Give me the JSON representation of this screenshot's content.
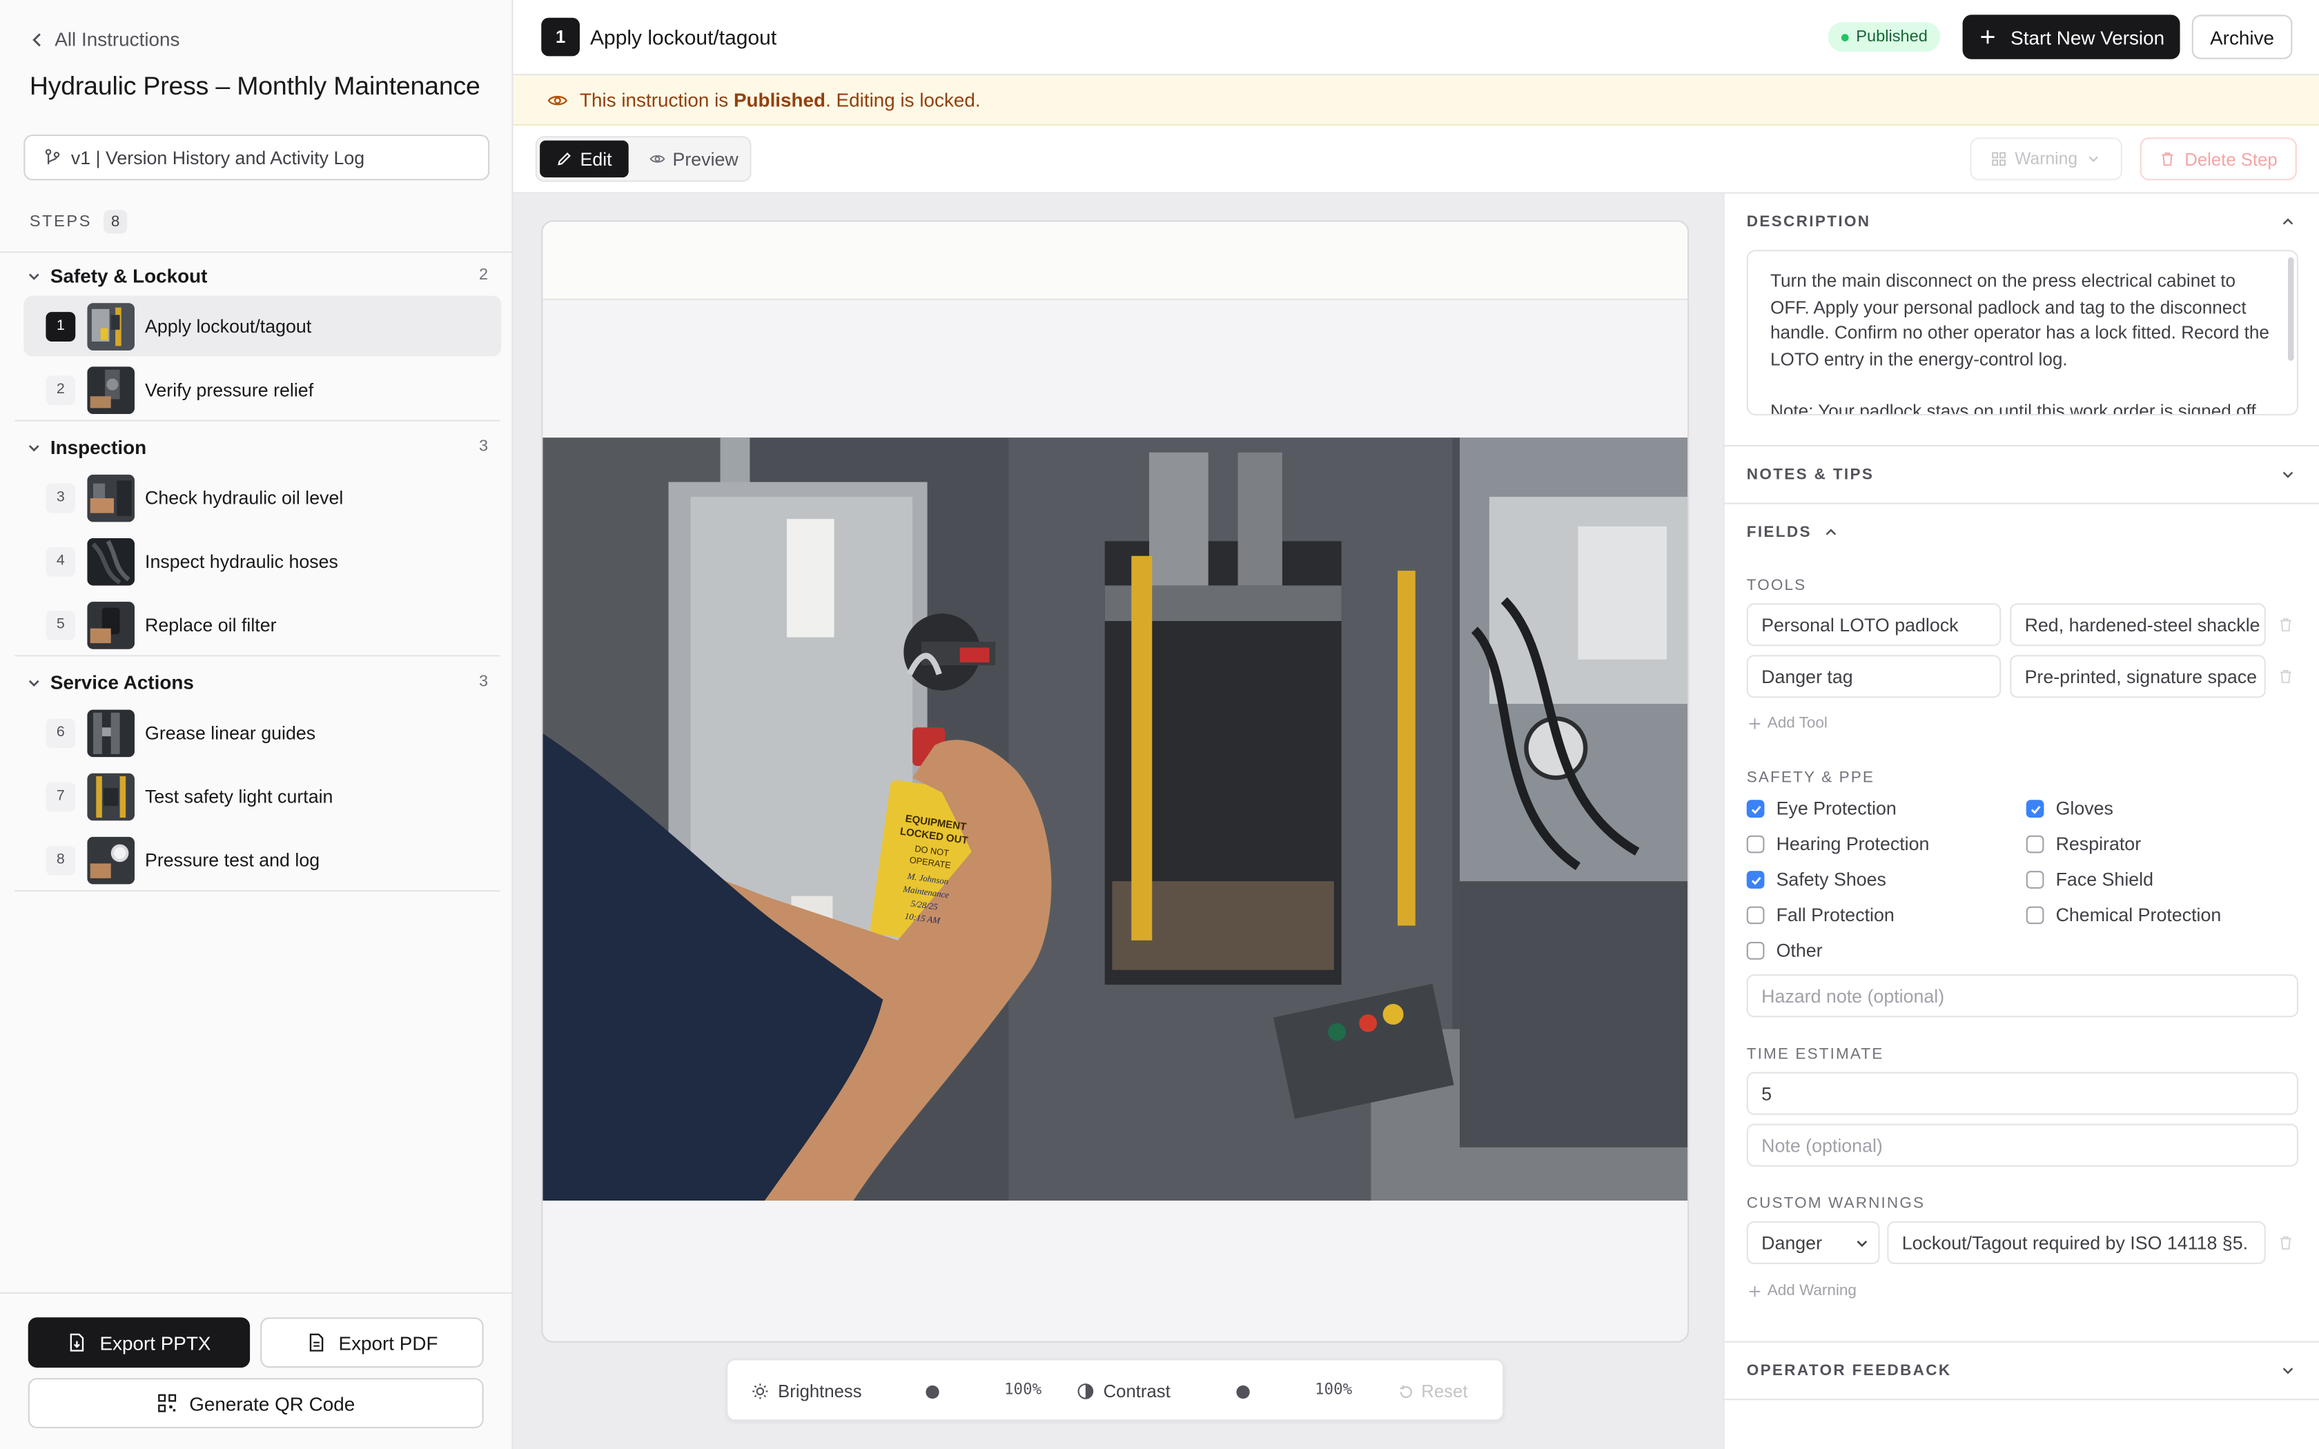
{
  "sidebar": {
    "back_label": "All Instructions",
    "title": "Hydraulic Press – Monthly Maintenance",
    "version_label": "v1 | Version History and Activity Log",
    "steps_label": "STEPS",
    "steps_count": "8",
    "groups": [
      {
        "name": "Safety & Lockout",
        "count": "2"
      },
      {
        "name": "Inspection",
        "count": "3"
      },
      {
        "name": "Service Actions",
        "count": "3"
      }
    ],
    "steps": [
      {
        "num": "1",
        "label": "Apply lockout/tagout"
      },
      {
        "num": "2",
        "label": "Verify pressure relief"
      },
      {
        "num": "3",
        "label": "Check hydraulic oil level"
      },
      {
        "num": "4",
        "label": "Inspect hydraulic hoses"
      },
      {
        "num": "5",
        "label": "Replace oil filter"
      },
      {
        "num": "6",
        "label": "Grease linear guides"
      },
      {
        "num": "7",
        "label": "Test safety light curtain"
      },
      {
        "num": "8",
        "label": "Pressure test and log"
      }
    ],
    "export_pptx": "Export PPTX",
    "export_pdf": "Export PDF",
    "qr_label": "Generate QR Code"
  },
  "header": {
    "step_num": "1",
    "step_title": "Apply lockout/tagout",
    "status": "Published",
    "new_version": "Start New Version",
    "archive": "Archive"
  },
  "banner": {
    "prefix": "This instruction is ",
    "status": "Published",
    "suffix": ". Editing is locked."
  },
  "toolbar": {
    "edit": "Edit",
    "preview": "Preview",
    "warning": "Warning",
    "delete": "Delete Step"
  },
  "adjust": {
    "brightness": "Brightness",
    "brightness_value": "100%",
    "contrast": "Contrast",
    "contrast_value": "100%",
    "reset": "Reset"
  },
  "photo": {
    "tag_line1": "EQUIPMENT",
    "tag_line2": "LOCKED OUT",
    "tag_line3": "DO NOT",
    "tag_line4": "OPERATE",
    "tag_name": "M. Johnson",
    "tag_dept": "Maintenance",
    "tag_date": "5/28/25",
    "tag_time": "10:15 AM"
  },
  "panel": {
    "description_label": "DESCRIPTION",
    "description_p1": "Turn the main disconnect on the press electrical cabinet to OFF. Apply your personal padlock and tag to the disconnect handle. Confirm no other operator has a lock fitted. Record the LOTO entry in the energy-control log.",
    "description_p2": "Note: Your padlock stays on until this work order is signed off.",
    "notes_label": "NOTES & TIPS",
    "fields_label": "FIELDS",
    "tools_label": "TOOLS",
    "tools": [
      {
        "name": "Personal LOTO padlock",
        "detail": "Red, hardened-steel shackle"
      },
      {
        "name": "Danger tag",
        "detail": "Pre-printed, signature space"
      }
    ],
    "add_tool": "Add Tool",
    "ppe_label": "SAFETY & PPE",
    "ppe": [
      {
        "label": "Eye Protection",
        "checked": true
      },
      {
        "label": "Gloves",
        "checked": true
      },
      {
        "label": "Hearing Protection",
        "checked": false
      },
      {
        "label": "Respirator",
        "checked": false
      },
      {
        "label": "Safety Shoes",
        "checked": true
      },
      {
        "label": "Face Shield",
        "checked": false
      },
      {
        "label": "Fall Protection",
        "checked": false
      },
      {
        "label": "Chemical Protection",
        "checked": false
      },
      {
        "label": "Other",
        "checked": false
      }
    ],
    "hazard_placeholder": "Hazard note (optional)",
    "time_label": "TIME ESTIMATE",
    "time_value": "5",
    "time_note_placeholder": "Note (optional)",
    "warnings_label": "CUSTOM WARNINGS",
    "warning_level": "Danger",
    "warning_text": "Lockout/Tagout required by ISO 14118 §5.",
    "add_warning": "Add Warning",
    "feedback_label": "OPERATOR FEEDBACK"
  },
  "colors": {
    "accent": "#18181b",
    "published_bg": "#dcfce7",
    "published_text": "#166534",
    "banner_bg": "#fef9e7",
    "banner_text": "#92400e",
    "checkbox": "#3b82f6",
    "danger": "#f4a5a5"
  }
}
